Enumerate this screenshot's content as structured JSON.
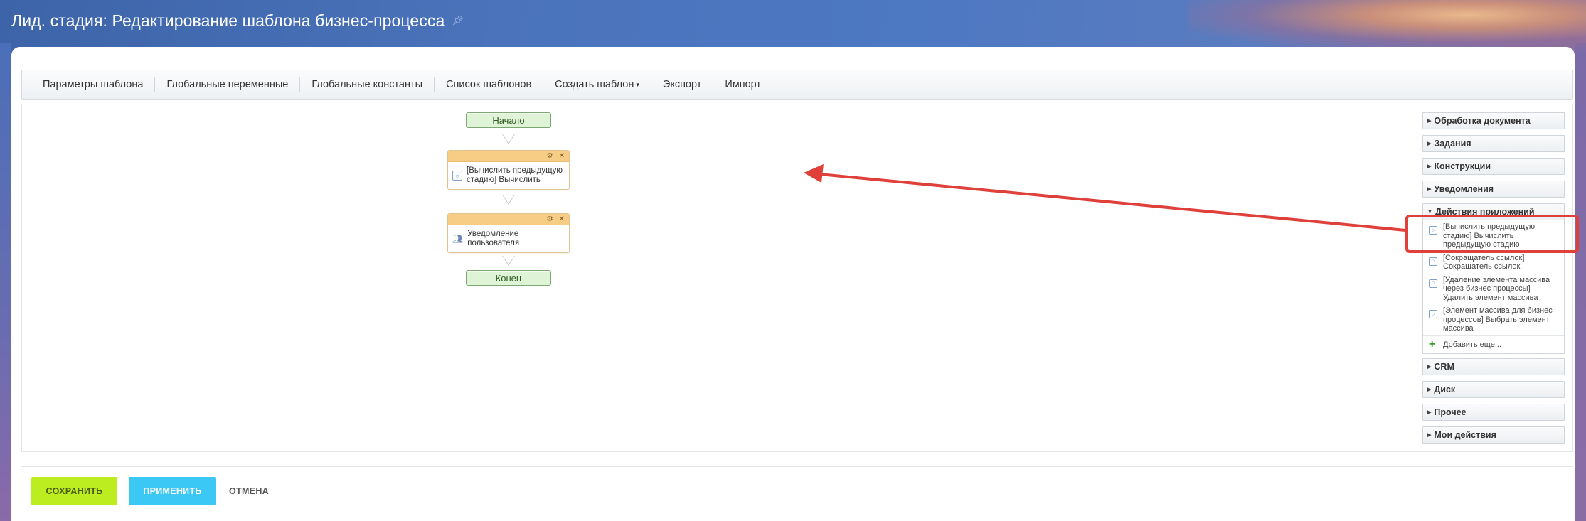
{
  "page": {
    "title": "Лид. стадия: Редактирование шаблона бизнес-процесса"
  },
  "toolbar": {
    "items": [
      "Параметры шаблона",
      "Глобальные переменные",
      "Глобальные константы",
      "Список шаблонов",
      "Создать шаблон",
      "Экспорт",
      "Импорт"
    ]
  },
  "workflow": {
    "start_label": "Начало",
    "end_label": "Конец",
    "activities": [
      {
        "text": "[Вычислить предыдущую стадию] Вычислить",
        "icon": "app-activity-icon"
      },
      {
        "text": "Уведомление пользователя",
        "icon": "user-notify-icon"
      }
    ]
  },
  "sidebar": {
    "groups_top": [
      "Обработка документа",
      "Задания",
      "Конструкции",
      "Уведомления"
    ],
    "expanded_group": "Действия приложений",
    "expanded_items": [
      "[Вычислить предыдущую стадию] Вычислить предыдущую стадию",
      "[Сокращатель ссылок] Сокращатель ссылок",
      "[Удаление элемента массива через бизнес процессы] Удалить элемент массива",
      "[Элемент массива для бизнес процессов] Выбрать элемент массива"
    ],
    "add_more": "Добавить еще...",
    "groups_bottom": [
      "CRM",
      "Диск",
      "Прочее",
      "Мои действия"
    ]
  },
  "footer": {
    "save": "СОХРАНИТЬ",
    "apply": "ПРИМЕНИТЬ",
    "cancel": "ОТМЕНА"
  },
  "colors": {
    "save": "#bbed21",
    "apply": "#3bc8f5",
    "annotation": "#e0403a",
    "activity_header": "#f7cd85",
    "terminal_node": "#dff3d6"
  }
}
